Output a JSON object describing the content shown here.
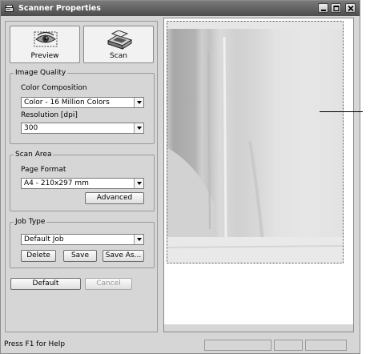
{
  "window": {
    "title": "Scanner Properties"
  },
  "toolbar": {
    "preview_label": "Preview",
    "scan_label": "Scan"
  },
  "image_quality": {
    "group_title": "Image Quality",
    "color_label": "Color Composition",
    "color_value": "Color - 16 Million Colors",
    "resolution_label": "Resolution [dpi]",
    "resolution_value": "300"
  },
  "scan_area": {
    "group_title": "Scan Area",
    "page_format_label": "Page Format",
    "page_format_value": "A4 - 210x297 mm",
    "advanced_label": "Advanced"
  },
  "job_type": {
    "group_title": "Job Type",
    "job_value": "Default Job",
    "delete_label": "Delete",
    "save_label": "Save",
    "save_as_label": "Save As..."
  },
  "footer_buttons": {
    "default_label": "Default",
    "cancel_label": "Cancel"
  },
  "status": {
    "help_text": "Press F1 for Help"
  },
  "icons": {
    "title": "scanner-icon",
    "preview": "eye-preview-icon",
    "scan": "scanner-device-icon",
    "minimize": "minimize-icon",
    "maximize": "maximize-icon",
    "close": "close-icon"
  }
}
